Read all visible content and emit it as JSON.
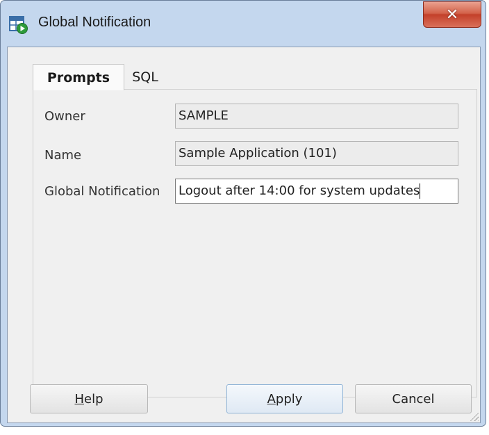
{
  "window": {
    "title": "Global Notification",
    "close_glyph": "✕"
  },
  "tabs": [
    {
      "label": "Prompts",
      "active": true
    },
    {
      "label": "SQL",
      "active": false
    }
  ],
  "form": {
    "owner": {
      "label": "Owner",
      "value": "SAMPLE",
      "editable": false
    },
    "name": {
      "label": "Name",
      "value": "Sample Application (101)",
      "editable": false
    },
    "notification": {
      "label": "Global Notification",
      "value": "Logout after 14:00 for system updates",
      "editable": true
    }
  },
  "buttons": {
    "help": {
      "label": "Help",
      "mnemonic": "H",
      "rest": "elp"
    },
    "apply": {
      "label": "Apply",
      "mnemonic": "A",
      "rest": "pply"
    },
    "cancel": {
      "label": "Cancel"
    }
  },
  "icons": {
    "app": "table-run-icon",
    "close": "close-icon",
    "resize": "resize-grip-icon"
  },
  "colors": {
    "close_button": "#c3402a",
    "frame": "#c4d7ee",
    "client": "#f0f0f0"
  }
}
